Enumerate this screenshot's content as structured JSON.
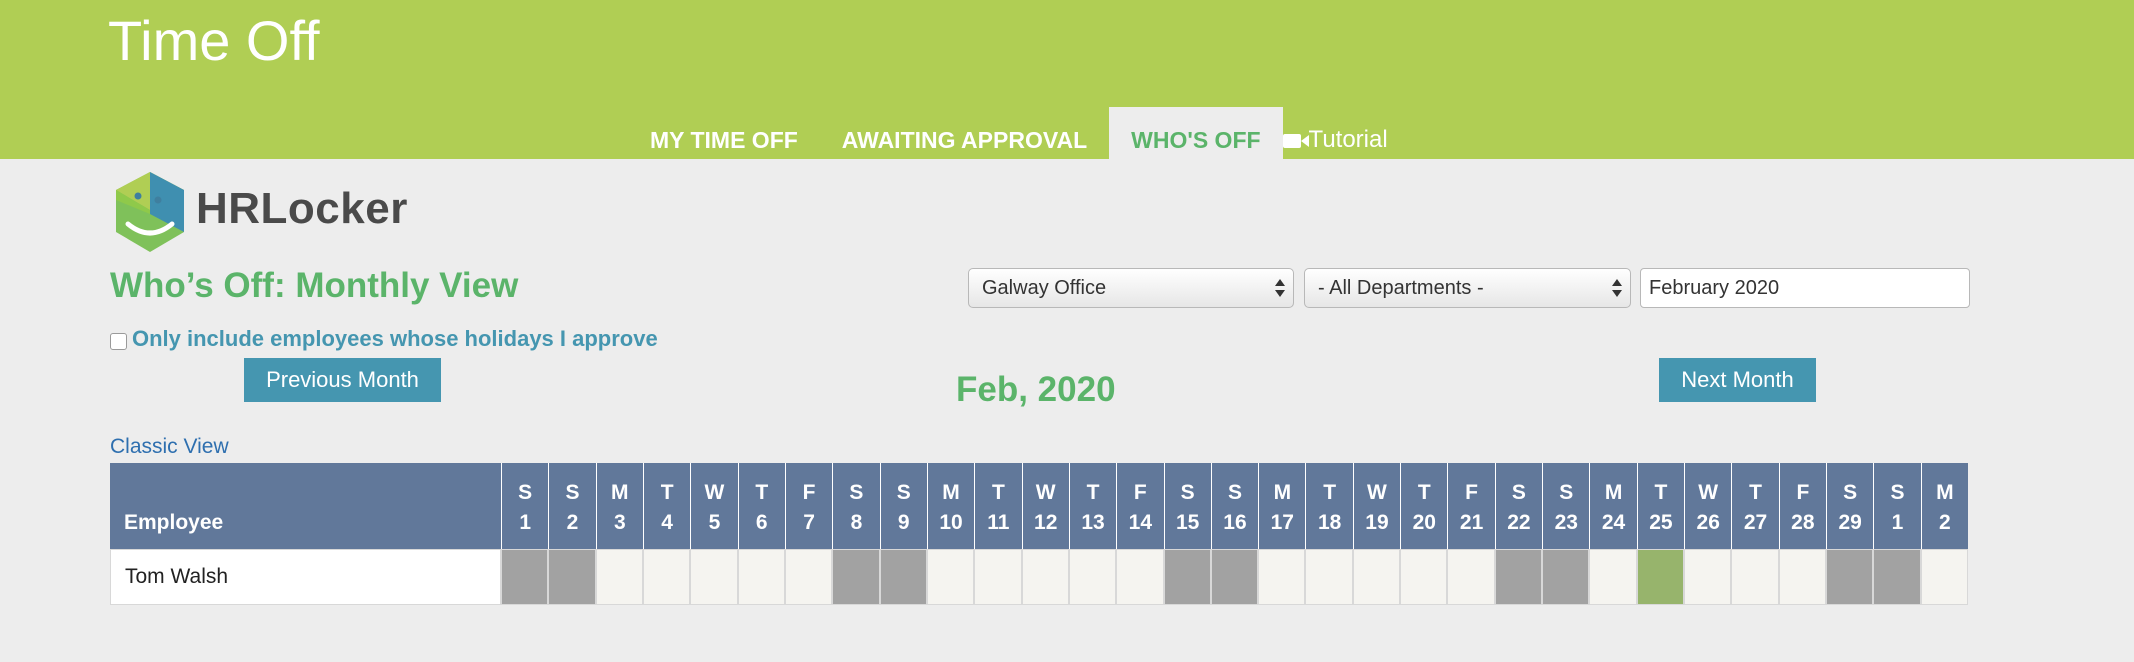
{
  "app_title": "Time Off",
  "tabs": [
    {
      "label": "MY TIME OFF",
      "active": false
    },
    {
      "label": "AWAITING APPROVAL",
      "active": false
    },
    {
      "label": "WHO'S OFF",
      "active": true
    },
    {
      "label": "Tutorial",
      "active": false,
      "icon": "video-camera-icon"
    }
  ],
  "logo": {
    "text": "HRLocker",
    "colors": {
      "blue": "#3f8fb0",
      "green": "#7fc15a",
      "face": "#b0ce54"
    }
  },
  "page_title": "Who’s Off: Monthly View",
  "filters": {
    "office": "Galway Office",
    "department": "- All Departments -",
    "month": "February 2020"
  },
  "approval_filter": {
    "label": "Only include employees whose holidays I approve",
    "checked": false
  },
  "buttons": {
    "previous": "Previous Month",
    "next": "Next Month"
  },
  "current_month": "Feb, 2020",
  "classic_view": "Classic View",
  "calendar": {
    "employee_header": "Employee",
    "days": [
      {
        "letter": "S",
        "num": "1"
      },
      {
        "letter": "S",
        "num": "2"
      },
      {
        "letter": "M",
        "num": "3"
      },
      {
        "letter": "T",
        "num": "4"
      },
      {
        "letter": "W",
        "num": "5"
      },
      {
        "letter": "T",
        "num": "6"
      },
      {
        "letter": "F",
        "num": "7"
      },
      {
        "letter": "S",
        "num": "8"
      },
      {
        "letter": "S",
        "num": "9"
      },
      {
        "letter": "M",
        "num": "10"
      },
      {
        "letter": "T",
        "num": "11"
      },
      {
        "letter": "W",
        "num": "12"
      },
      {
        "letter": "T",
        "num": "13"
      },
      {
        "letter": "F",
        "num": "14"
      },
      {
        "letter": "S",
        "num": "15"
      },
      {
        "letter": "S",
        "num": "16"
      },
      {
        "letter": "M",
        "num": "17"
      },
      {
        "letter": "T",
        "num": "18"
      },
      {
        "letter": "W",
        "num": "19"
      },
      {
        "letter": "T",
        "num": "20"
      },
      {
        "letter": "F",
        "num": "21"
      },
      {
        "letter": "S",
        "num": "22"
      },
      {
        "letter": "S",
        "num": "23"
      },
      {
        "letter": "M",
        "num": "24"
      },
      {
        "letter": "T",
        "num": "25"
      },
      {
        "letter": "W",
        "num": "26"
      },
      {
        "letter": "T",
        "num": "27"
      },
      {
        "letter": "F",
        "num": "28"
      },
      {
        "letter": "S",
        "num": "29"
      },
      {
        "letter": "S",
        "num": "1"
      },
      {
        "letter": "M",
        "num": "2"
      }
    ],
    "employees": [
      {
        "name": "Tom Walsh",
        "off_days": [
          25
        ]
      }
    ]
  },
  "colors": {
    "header_green": "#b0ce54",
    "title_green": "#5bb46a",
    "button_blue": "#4596b0",
    "table_header": "#61789a",
    "weekend_gray": "#a2a2a2",
    "time_off_green": "#97b46c"
  }
}
